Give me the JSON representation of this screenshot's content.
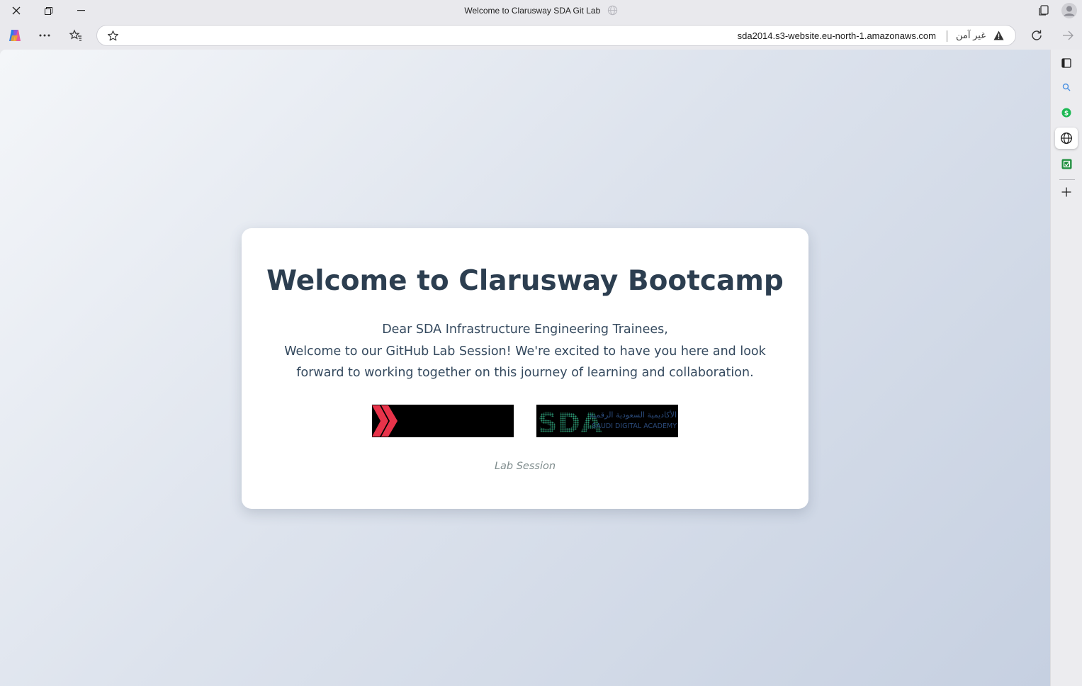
{
  "window": {
    "title": "Welcome to Clarusway SDA Git Lab"
  },
  "address_bar": {
    "url": "sda2014.s3-website.eu-north-1.amazonaws.com",
    "security_label": "غير آمن"
  },
  "page": {
    "heading": "Welcome to Clarusway Bootcamp",
    "greeting": "Dear SDA Infrastructure Engineering Trainees,",
    "message": "Welcome to our GitHub Lab Session! We're excited to have you here and look forward to working together on this journey of learning and collaboration.",
    "logos": [
      {
        "name": "Clarusway logo"
      },
      {
        "name": "Saudi Digital Academy logo",
        "text": "SDA",
        "arabic": "الأكاديمية السعودية الرقمية",
        "english": "SAUDI DIGITAL ACADEMY"
      }
    ],
    "footer_note": "Lab Session"
  },
  "colors": {
    "heading": "#2c3e50",
    "body_text": "#34495e",
    "muted": "#7f8c8d",
    "clarusway_red": "#e8334a",
    "sda_green": "#2e9a6e"
  }
}
